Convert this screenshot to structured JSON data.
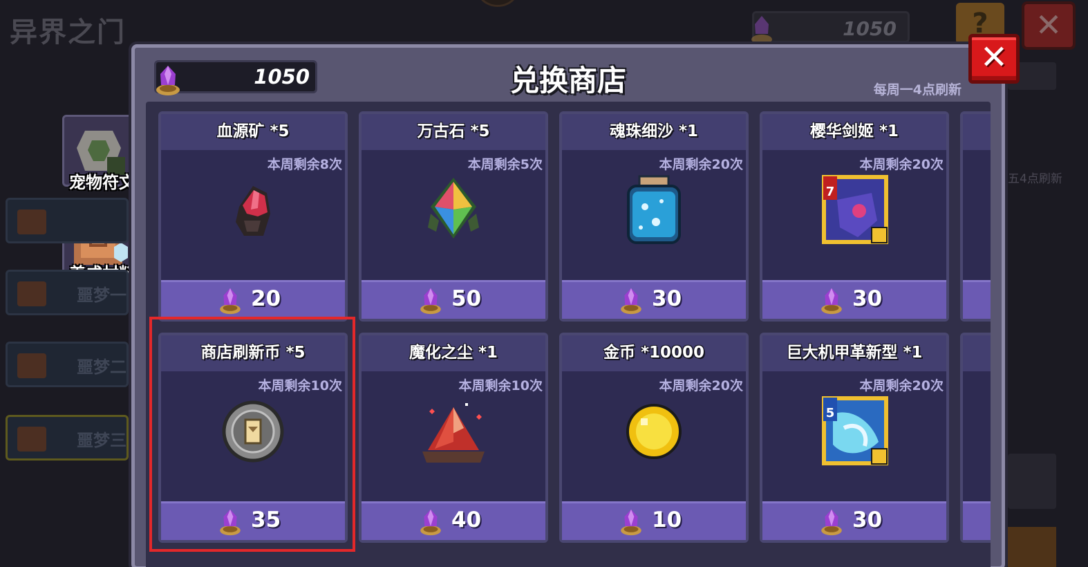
{
  "background": {
    "title": "异界之门",
    "currency_value": "1050",
    "help_label": "?",
    "close_label": "✕",
    "side_features": [
      "宠物符文",
      "养成材料"
    ],
    "side_buttons": [
      "",
      "噩梦一",
      "噩梦二",
      "噩梦三"
    ],
    "right_refresh_text": "五4点刷新"
  },
  "shop": {
    "title": "兑换商店",
    "currency_value": "1050",
    "currency_icon": "purple-gem-icon",
    "refresh_note": "每周一4点刷新",
    "close_label": "✕",
    "items": [
      {
        "name": "血源矿 *5",
        "limit": "本周剩余8次",
        "price": "20",
        "icon": "blood-ore-icon"
      },
      {
        "name": "万古石 *5",
        "limit": "本周剩余5次",
        "price": "50",
        "icon": "ancient-stone-icon"
      },
      {
        "name": "魂珠细沙 *1",
        "limit": "本周剩余20次",
        "price": "30",
        "icon": "soul-sand-jar-icon"
      },
      {
        "name": "樱华剑姬 *1",
        "limit": "本周剩余20次",
        "price": "30",
        "icon": "hero-card-icon"
      },
      {
        "name": "商店刷新币 *5",
        "limit": "本周剩余10次",
        "price": "35",
        "icon": "refresh-coin-icon"
      },
      {
        "name": "魔化之尘 *1",
        "limit": "本周剩余10次",
        "price": "40",
        "icon": "magic-dust-icon"
      },
      {
        "name": "金币 *10000",
        "limit": "本周剩余20次",
        "price": "10",
        "icon": "gold-coin-icon"
      },
      {
        "name": "巨大机甲革新型 *1",
        "limit": "本周剩余20次",
        "price": "30",
        "icon": "mecha-card-icon"
      }
    ],
    "card_levels": [
      "7",
      "5"
    ]
  },
  "colors": {
    "highlight": "#e3282a",
    "price_bar": "#6b5ab3",
    "card_bg": "#2e2b52"
  }
}
